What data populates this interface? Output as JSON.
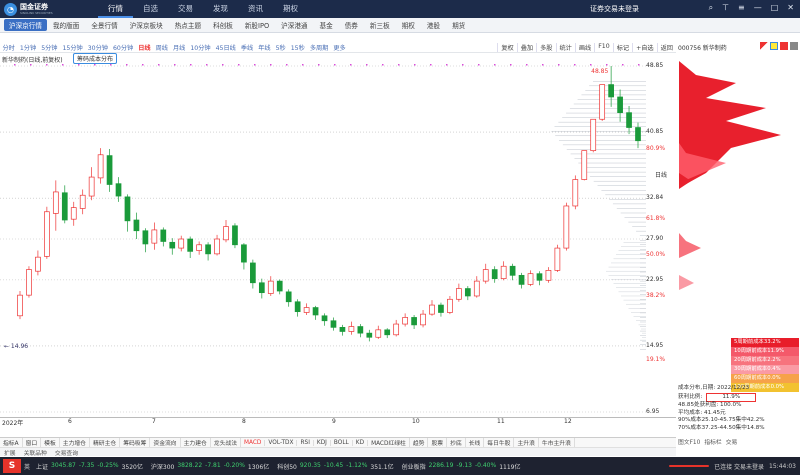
{
  "titlebar": {
    "brand": "国金证券",
    "brand_en": "SINOLINK SECURITIES",
    "menu": [
      "行情",
      "自选",
      "交易",
      "发现",
      "资讯",
      "期权"
    ],
    "active": "行情",
    "login": "证券交易未登录"
  },
  "subnav": {
    "items": [
      "沪深京行情",
      "我的版面",
      "全景行情",
      "沪深京板块",
      "热点主题",
      "科创板",
      "新股IPO",
      "沪深港通",
      "基金",
      "债券",
      "新三板",
      "期权",
      "港股",
      "期货"
    ]
  },
  "chart_toolbar": {
    "periods": [
      "分时",
      "1分钟",
      "5分钟",
      "15分钟",
      "30分钟",
      "60分钟",
      "日线",
      "周线",
      "月线",
      "10分钟",
      "45日线",
      "季线",
      "年线",
      "5秒",
      "15秒",
      "多周期",
      "更多"
    ],
    "active": "日线",
    "right": [
      "复权",
      "叠加",
      "多股",
      "统计",
      "画线",
      "F10",
      "标记",
      "+自选",
      "返回"
    ]
  },
  "right_panel": {
    "title": "000756 新华制药"
  },
  "stock_label": "新华制药(日线,前复权)",
  "chip_button": "筹码成本分布",
  "y_axis": {
    "labels": [
      "48.85",
      "40.85",
      "32.84",
      "27.90",
      "22.95",
      "14.95",
      "6.95"
    ],
    "pct_labels": [
      "80.9%",
      "61.8%",
      "50.0%",
      "38.2%",
      "19.1%"
    ],
    "top_annot": "48.85",
    "low_annot": "14.96",
    "bottom_annot": "日线"
  },
  "x_axis": {
    "labels": [
      "2022年",
      "6",
      "7",
      "8",
      "9",
      "10",
      "11",
      "12"
    ]
  },
  "legend": [
    {
      "label": "5周期前成本33.2%",
      "color": "#e81d2a"
    },
    {
      "label": "10周期前成本11.9%",
      "color": "#f4596a"
    },
    {
      "label": "20周期前成本2.2%",
      "color": "#f7737e"
    },
    {
      "label": "30周期前成本0.4%",
      "color": "#fa9aa4"
    },
    {
      "label": "60周期前成本0.0%",
      "color": "#f6a24a"
    },
    {
      "label": "100周期前成本0.0%",
      "color": "#f2c230"
    }
  ],
  "stats": {
    "date_label": "成本分布,日期: 2022/12/23",
    "profit_label": "获利比例:",
    "profit_value": "11.9%",
    "profit_line": "48.85处获利盘: 100.0%",
    "avg_cost": "平均成本: 41.45元",
    "c90": "90%成本25.10-45.75集中42.2%",
    "c70": "70%成本37.25-44.50集中14.8%"
  },
  "indicators": [
    "指标A",
    "窗口",
    "模板",
    "主力增仓",
    "精研主仓",
    "筹码吸筹",
    "资金流向",
    "主力建仓",
    "龙头战法",
    "MACD",
    "VOL-TDX",
    "RSI",
    "KDJ",
    "BOLL",
    "KD",
    "MACD红绿柱",
    "趋势",
    "股票",
    "抄底",
    "长线",
    "每日牛股",
    "主升浪",
    "牛市主升浪"
  ],
  "indicators_active": "MACD",
  "indicator_row2": [
    "扩展",
    "关联品种",
    "交易查询"
  ],
  "right_tabs": [
    "图文F10",
    "指标栏",
    "交易"
  ],
  "statusbar": {
    "indices": [
      {
        "name": "上证",
        "value": "3045.87",
        "chg": "-7.35",
        "pct": "-0.25%",
        "amt": "3520亿",
        "down": true
      },
      {
        "name": "沪深300",
        "value": "3828.22",
        "chg": "-7.81",
        "pct": "-0.20%",
        "amt": "1306亿",
        "down": true
      },
      {
        "name": "科创50",
        "value": "920.35",
        "chg": "-10.45",
        "pct": "-1.12%",
        "amt": "351.1亿",
        "down": true
      },
      {
        "name": "创业板指",
        "value": "2286.19",
        "chg": "-9.13",
        "pct": "-0.40%",
        "amt": "1119亿",
        "down": true
      }
    ],
    "ticker_left": "英",
    "conn": "已连接 交易未登录",
    "time": "15:44:03"
  },
  "chart_data": {
    "type": "candlestick",
    "x": [
      "2022-05",
      "2022-06",
      "2022-07",
      "2022-08",
      "2022-09",
      "2022-10",
      "2022-11",
      "2022-12"
    ],
    "y_range": [
      6.95,
      48.85
    ],
    "series": [
      {
        "values": [
          [
            18.6,
            21.1,
            18.2,
            21.6
          ],
          [
            21.1,
            24.2,
            20.8,
            24.6
          ],
          [
            24.0,
            25.7,
            23.5,
            26.5
          ],
          [
            25.8,
            31.2,
            25.5,
            31.8
          ],
          [
            31.0,
            33.6,
            28.9,
            35.0
          ],
          [
            33.5,
            30.2,
            29.8,
            34.4
          ],
          [
            30.3,
            31.7,
            29.5,
            32.4
          ],
          [
            31.6,
            33.2,
            30.9,
            33.9
          ],
          [
            33.1,
            35.4,
            32.6,
            36.6
          ],
          [
            35.3,
            38.1,
            34.6,
            38.9
          ],
          [
            38.0,
            34.5,
            33.6,
            38.8
          ],
          [
            34.6,
            33.1,
            32.4,
            35.4
          ],
          [
            33.0,
            30.1,
            28.8,
            33.3
          ],
          [
            30.2,
            28.9,
            27.9,
            31.1
          ],
          [
            28.9,
            27.3,
            26.3,
            29.2
          ],
          [
            27.4,
            29.0,
            26.6,
            29.9
          ],
          [
            29.0,
            27.6,
            27.0,
            29.3
          ],
          [
            27.5,
            26.8,
            26.0,
            28.0
          ],
          [
            26.8,
            27.9,
            26.4,
            28.3
          ],
          [
            27.9,
            26.4,
            25.6,
            28.2
          ],
          [
            26.5,
            27.2,
            26.0,
            27.6
          ],
          [
            27.2,
            26.1,
            25.3,
            27.5
          ],
          [
            26.1,
            27.9,
            25.9,
            28.4
          ],
          [
            27.8,
            29.4,
            27.5,
            30.2
          ],
          [
            29.5,
            27.2,
            26.8,
            29.8
          ],
          [
            27.2,
            25.1,
            24.2,
            27.4
          ],
          [
            25.0,
            22.6,
            21.9,
            25.4
          ],
          [
            22.6,
            21.4,
            20.7,
            23.1
          ],
          [
            21.3,
            22.8,
            21.0,
            23.4
          ],
          [
            22.8,
            21.6,
            21.2,
            23.0
          ],
          [
            21.5,
            20.3,
            19.7,
            21.8
          ],
          [
            20.3,
            19.1,
            18.5,
            20.6
          ],
          [
            19.0,
            19.6,
            18.7,
            20.1
          ],
          [
            19.6,
            18.7,
            18.1,
            19.8
          ],
          [
            18.6,
            18.0,
            17.4,
            18.9
          ],
          [
            18.0,
            17.2,
            16.8,
            18.4
          ],
          [
            17.2,
            16.7,
            16.2,
            17.5
          ],
          [
            16.7,
            17.3,
            16.3,
            17.9
          ],
          [
            17.3,
            16.5,
            16.0,
            17.6
          ],
          [
            16.5,
            16.0,
            15.5,
            16.9
          ],
          [
            16.0,
            16.9,
            15.8,
            17.4
          ],
          [
            16.9,
            16.3,
            15.9,
            17.1
          ],
          [
            16.3,
            17.6,
            16.1,
            18.1
          ],
          [
            17.6,
            18.4,
            17.3,
            18.9
          ],
          [
            18.4,
            17.5,
            17.0,
            18.7
          ],
          [
            17.5,
            18.8,
            17.2,
            19.3
          ],
          [
            18.8,
            19.9,
            18.6,
            20.5
          ],
          [
            19.9,
            19.0,
            18.5,
            20.2
          ],
          [
            19.0,
            20.6,
            18.8,
            21.0
          ],
          [
            20.6,
            21.9,
            20.3,
            22.5
          ],
          [
            21.9,
            21.0,
            20.5,
            22.2
          ],
          [
            21.0,
            22.8,
            20.8,
            23.4
          ],
          [
            22.8,
            24.2,
            22.5,
            24.9
          ],
          [
            24.2,
            23.1,
            22.6,
            24.6
          ],
          [
            23.1,
            24.6,
            22.9,
            25.2
          ],
          [
            24.6,
            23.5,
            22.9,
            24.9
          ],
          [
            23.5,
            22.4,
            21.9,
            23.8
          ],
          [
            22.4,
            23.7,
            22.2,
            24.1
          ],
          [
            23.7,
            22.9,
            22.3,
            24.0
          ],
          [
            22.9,
            24.1,
            22.6,
            24.5
          ],
          [
            24.1,
            26.8,
            23.9,
            27.2
          ],
          [
            26.8,
            31.9,
            26.5,
            32.3
          ],
          [
            31.9,
            35.1,
            31.5,
            35.6
          ],
          [
            35.1,
            38.6,
            35.0,
            38.6
          ],
          [
            38.6,
            42.4,
            38.4,
            42.4
          ],
          [
            42.4,
            46.6,
            42.2,
            46.6
          ],
          [
            46.6,
            45.1,
            43.9,
            48.85
          ],
          [
            45.1,
            43.2,
            42.1,
            46.0
          ],
          [
            43.2,
            41.4,
            40.6,
            44.0
          ],
          [
            41.4,
            39.8,
            38.9,
            42.0
          ]
        ]
      }
    ]
  }
}
